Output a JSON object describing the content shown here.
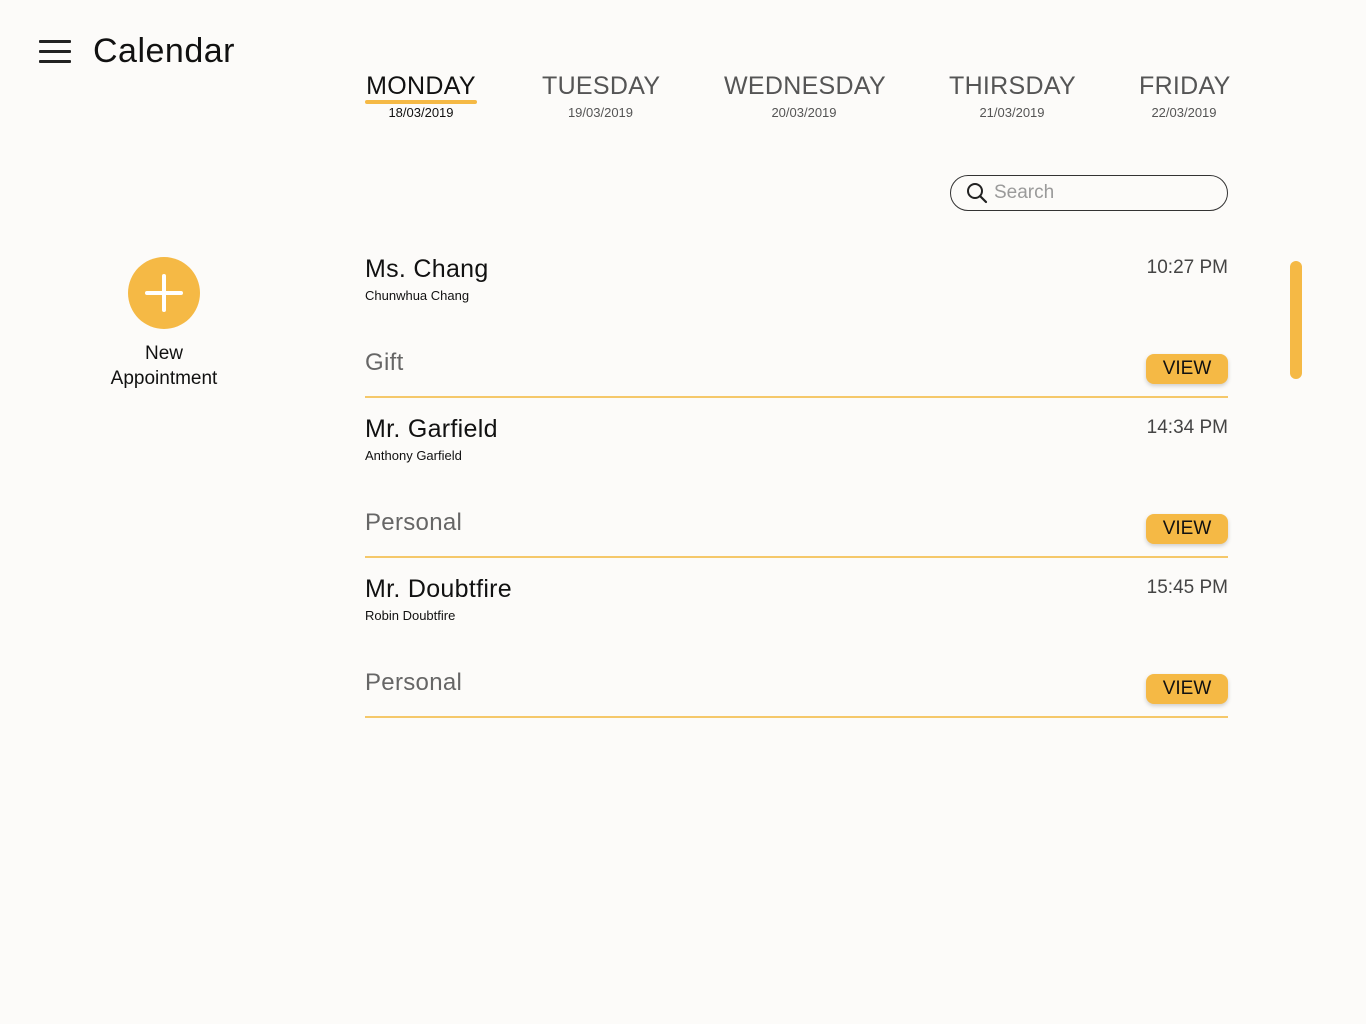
{
  "header": {
    "title": "Calendar",
    "menu_icon": "hamburger-menu-icon"
  },
  "tabs": [
    {
      "day": "MONDAY",
      "date": "18/03/2019",
      "active": true
    },
    {
      "day": "TUESDAY",
      "date": "19/03/2019",
      "active": false
    },
    {
      "day": "WEDNESDAY",
      "date": "20/03/2019",
      "active": false
    },
    {
      "day": "THIRSDAY",
      "date": "21/03/2019",
      "active": false
    },
    {
      "day": "FRIDAY",
      "date": "22/03/2019",
      "active": false
    }
  ],
  "search": {
    "placeholder": "Search",
    "value": "",
    "icon": "search-icon"
  },
  "new_appointment": {
    "label_line1": "New",
    "label_line2": "Appointment",
    "icon": "plus-circle-icon"
  },
  "appointments": [
    {
      "name": "Ms. Chang",
      "full_name": "Chunwhua Chang",
      "time": "10:27 PM",
      "category": "Gift",
      "action": "VIEW"
    },
    {
      "name": "Mr. Garfield",
      "full_name": "Anthony Garfield",
      "time": "14:34 PM",
      "category": "Personal",
      "action": "VIEW"
    },
    {
      "name": "Mr. Doubtfire",
      "full_name": "Robin Doubtfire",
      "time": "15:45 PM",
      "category": "Personal",
      "action": "VIEW"
    }
  ],
  "colors": {
    "accent": "#f5b945",
    "background": "#fcfbf9",
    "divider": "#f5c86a"
  }
}
